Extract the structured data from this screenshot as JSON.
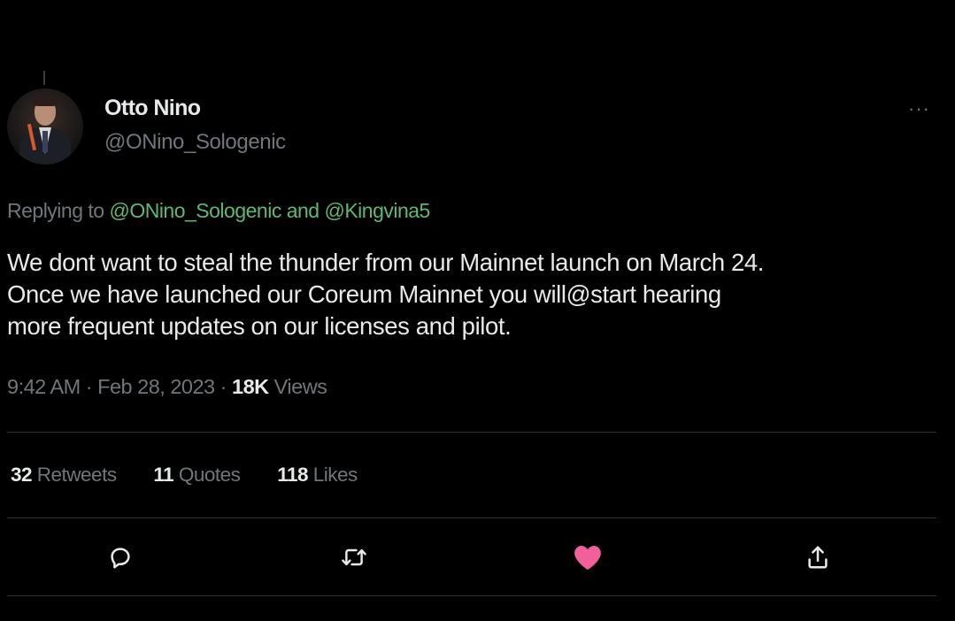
{
  "author": {
    "display_name": "Otto Nino",
    "handle": "@ONino_Sologenic"
  },
  "replying": {
    "prefix": "Replying to ",
    "mention_1": "@ONino_Sologenic",
    "conjunction": " and ",
    "mention_2": "@Kingvina5"
  },
  "tweet": {
    "text": "We dont want to steal the thunder from our Mainnet launch on March 24.\nOnce we have launched our Coreum Mainnet you will@start hearing\nmore frequent updates on our licenses and pilot."
  },
  "meta": {
    "time": "9:42 AM",
    "separator_1": " · ",
    "date": "Feb 28, 2023",
    "separator_2": " · ",
    "views_count": "18K",
    "views_label": " Views"
  },
  "stats": {
    "retweets_count": "32",
    "retweets_label": " Retweets",
    "quotes_count": "11",
    "quotes_label": " Quotes",
    "likes_count": "118",
    "likes_label": " Likes"
  },
  "icons": {
    "more": "more-icon",
    "reply": "reply-icon",
    "retweet": "retweet-icon",
    "like": "heart-icon",
    "share": "share-icon"
  },
  "colors": {
    "background": "#000000",
    "text": "#e7e9ea",
    "secondary": "#71767b",
    "mention": "#5fb872",
    "like_active": "#f0619b",
    "divider": "#2f3336"
  }
}
